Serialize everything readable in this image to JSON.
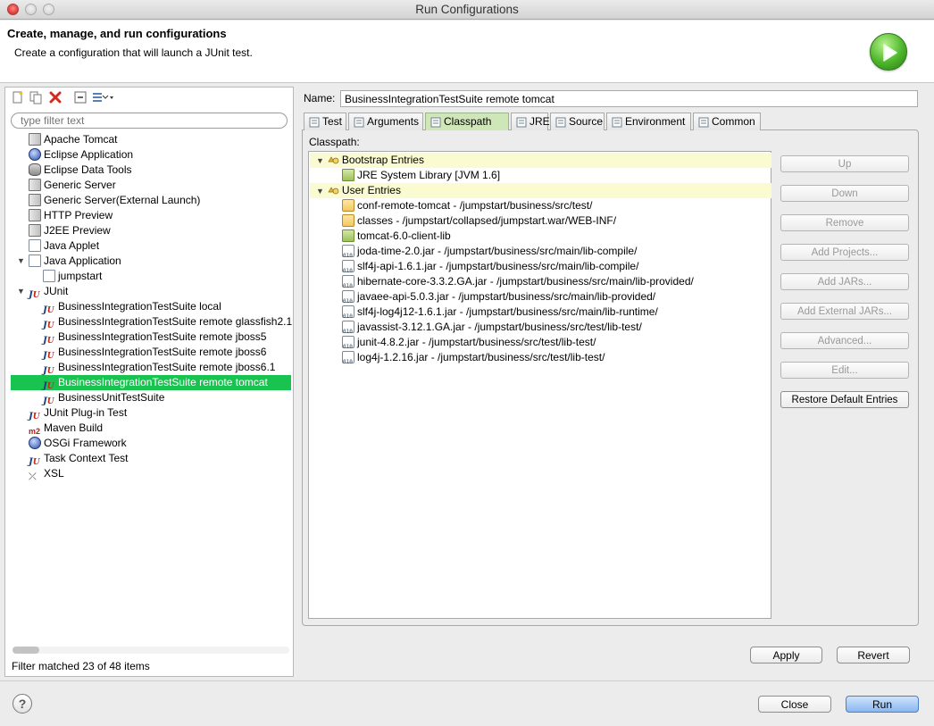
{
  "window": {
    "title": "Run Configurations"
  },
  "header": {
    "title": "Create, manage, and run configurations",
    "subtitle": "Create a configuration that will launch a JUnit test."
  },
  "left": {
    "filter_placeholder": "type filter text",
    "status": "Filter matched 23 of 48 items",
    "toolbar": [
      "new-config-icon",
      "duplicate-icon",
      "delete-icon",
      "collapse-all-icon",
      "filter-icon"
    ],
    "tree": [
      {
        "label": "Apache Tomcat",
        "icon": "server-icon",
        "level": 1
      },
      {
        "label": "Eclipse Application",
        "icon": "eclipse-icon",
        "level": 1
      },
      {
        "label": "Eclipse Data Tools",
        "icon": "data-icon",
        "level": 1
      },
      {
        "label": "Generic Server",
        "icon": "server-icon",
        "level": 1
      },
      {
        "label": "Generic Server(External Launch)",
        "icon": "server-icon",
        "level": 1
      },
      {
        "label": "HTTP Preview",
        "icon": "server-icon",
        "level": 1
      },
      {
        "label": "J2EE Preview",
        "icon": "server-icon",
        "level": 1
      },
      {
        "label": "Java Applet",
        "icon": "applet-icon",
        "level": 1
      },
      {
        "label": "Java Application",
        "icon": "java-app-icon",
        "level": 1,
        "expanded": true
      },
      {
        "label": "jumpstart",
        "icon": "java-file-icon",
        "level": 2
      },
      {
        "label": "JUnit",
        "icon": "junit-icon",
        "level": 1,
        "expanded": true
      },
      {
        "label": "BusinessIntegrationTestSuite local",
        "icon": "junit-icon",
        "level": 2
      },
      {
        "label": "BusinessIntegrationTestSuite remote glassfish2.1",
        "icon": "junit-icon",
        "level": 2
      },
      {
        "label": "BusinessIntegrationTestSuite remote jboss5",
        "icon": "junit-icon",
        "level": 2
      },
      {
        "label": "BusinessIntegrationTestSuite remote jboss6",
        "icon": "junit-icon",
        "level": 2
      },
      {
        "label": "BusinessIntegrationTestSuite remote jboss6.1",
        "icon": "junit-icon",
        "level": 2
      },
      {
        "label": "BusinessIntegrationTestSuite remote tomcat",
        "icon": "junit-icon",
        "level": 2,
        "selected": true
      },
      {
        "label": "BusinessUnitTestSuite",
        "icon": "junit-icon",
        "level": 2
      },
      {
        "label": "JUnit Plug-in Test",
        "icon": "junit-plugin-icon",
        "level": 1
      },
      {
        "label": "Maven Build",
        "icon": "maven-icon",
        "level": 1
      },
      {
        "label": "OSGi Framework",
        "icon": "osgi-icon",
        "level": 1
      },
      {
        "label": "Task Context Test",
        "icon": "junit-icon",
        "level": 1
      },
      {
        "label": "XSL",
        "icon": "xsl-icon",
        "level": 1
      }
    ]
  },
  "config": {
    "name_label": "Name:",
    "name_value": "BusinessIntegrationTestSuite remote tomcat",
    "tabs": [
      {
        "label": "Test",
        "icon": "test-tab-icon"
      },
      {
        "label": "Arguments",
        "icon": "arguments-tab-icon"
      },
      {
        "label": "Classpath",
        "icon": "classpath-tab-icon",
        "active": true
      },
      {
        "label": "JRE",
        "icon": "jre-tab-icon"
      },
      {
        "label": "Source",
        "icon": "source-tab-icon"
      },
      {
        "label": "Environment",
        "icon": "environment-tab-icon"
      },
      {
        "label": "Common",
        "icon": "common-tab-icon"
      }
    ],
    "classpath_label": "Classpath:",
    "entries": [
      {
        "label": "Bootstrap Entries",
        "type": "group"
      },
      {
        "label": "JRE System Library [JVM 1.6]",
        "type": "library"
      },
      {
        "label": "User Entries",
        "type": "group"
      },
      {
        "label": "conf-remote-tomcat - /jumpstart/business/src/test/",
        "type": "folder"
      },
      {
        "label": "classes - /jumpstart/collapsed/jumpstart.war/WEB-INF/",
        "type": "folder"
      },
      {
        "label": "tomcat-6.0-client-lib",
        "type": "library"
      },
      {
        "label": "joda-time-2.0.jar - /jumpstart/business/src/main/lib-compile/",
        "type": "jar"
      },
      {
        "label": "slf4j-api-1.6.1.jar - /jumpstart/business/src/main/lib-compile/",
        "type": "jar"
      },
      {
        "label": "hibernate-core-3.3.2.GA.jar - /jumpstart/business/src/main/lib-provided/",
        "type": "jar"
      },
      {
        "label": "javaee-api-5.0.3.jar - /jumpstart/business/src/main/lib-provided/",
        "type": "jar"
      },
      {
        "label": "slf4j-log4j12-1.6.1.jar - /jumpstart/business/src/main/lib-runtime/",
        "type": "jar"
      },
      {
        "label": "javassist-3.12.1.GA.jar - /jumpstart/business/src/test/lib-test/",
        "type": "jar"
      },
      {
        "label": "junit-4.8.2.jar - /jumpstart/business/src/test/lib-test/",
        "type": "jar"
      },
      {
        "label": "log4j-1.2.16.jar - /jumpstart/business/src/test/lib-test/",
        "type": "jar"
      }
    ],
    "side_buttons": [
      {
        "label": "Up",
        "enabled": false
      },
      {
        "label": "Down",
        "enabled": false
      },
      {
        "label": "Remove",
        "enabled": false
      },
      {
        "label": "Add Projects...",
        "enabled": false
      },
      {
        "label": "Add JARs...",
        "enabled": false
      },
      {
        "label": "Add External JARs...",
        "enabled": false
      },
      {
        "label": "Advanced...",
        "enabled": false
      },
      {
        "label": "Edit...",
        "enabled": false
      },
      {
        "label": "Restore Default Entries",
        "enabled": true
      }
    ],
    "apply_label": "Apply",
    "revert_label": "Revert"
  },
  "footer": {
    "help_label": "?",
    "close_label": "Close",
    "run_label": "Run"
  },
  "colors": {
    "selection": "#19c34f",
    "active_tab": "#cfe6b9",
    "group_row": "#fbfbd2",
    "run_button": "#8ab7f0"
  }
}
